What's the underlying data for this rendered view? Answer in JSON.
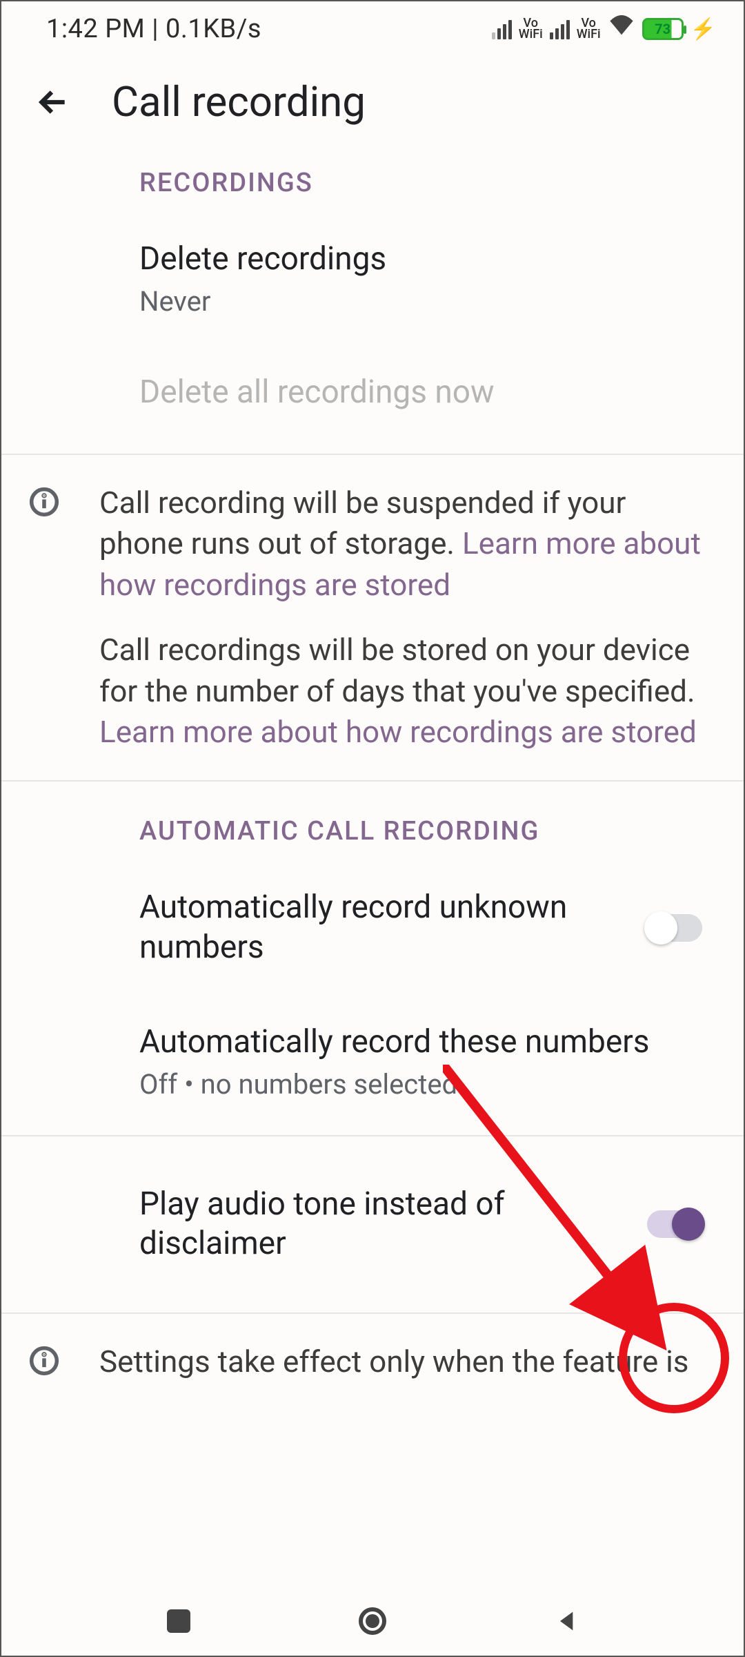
{
  "status_bar": {
    "time_and_rate": "1:42 PM | 0.1KB/s",
    "battery_pct": "73"
  },
  "header": {
    "title": "Call recording"
  },
  "sections": {
    "recordings": {
      "header": "RECORDINGS",
      "delete": {
        "title": "Delete recordings",
        "value": "Never"
      },
      "delete_all": {
        "title": "Delete all recordings now"
      }
    },
    "info1": {
      "p1_text": "Call recording will be suspended if your phone runs out of storage. ",
      "p1_link": "Learn more about how recordings are stored",
      "p2_text": "Call recordings will be stored on your device for the number of days that you've specified. ",
      "p2_link": "Learn more about how recordings are stored"
    },
    "auto": {
      "header": "AUTOMATIC CALL RECORDING",
      "unknown": {
        "title": "Automatically record unknown numbers",
        "on": false
      },
      "these": {
        "title": "Automatically record these numbers",
        "value": "Off • no numbers selected"
      }
    },
    "tone": {
      "title": "Play audio tone instead of disclaimer",
      "on": true
    },
    "info2": {
      "text": "Settings take effect only when the feature is"
    }
  }
}
